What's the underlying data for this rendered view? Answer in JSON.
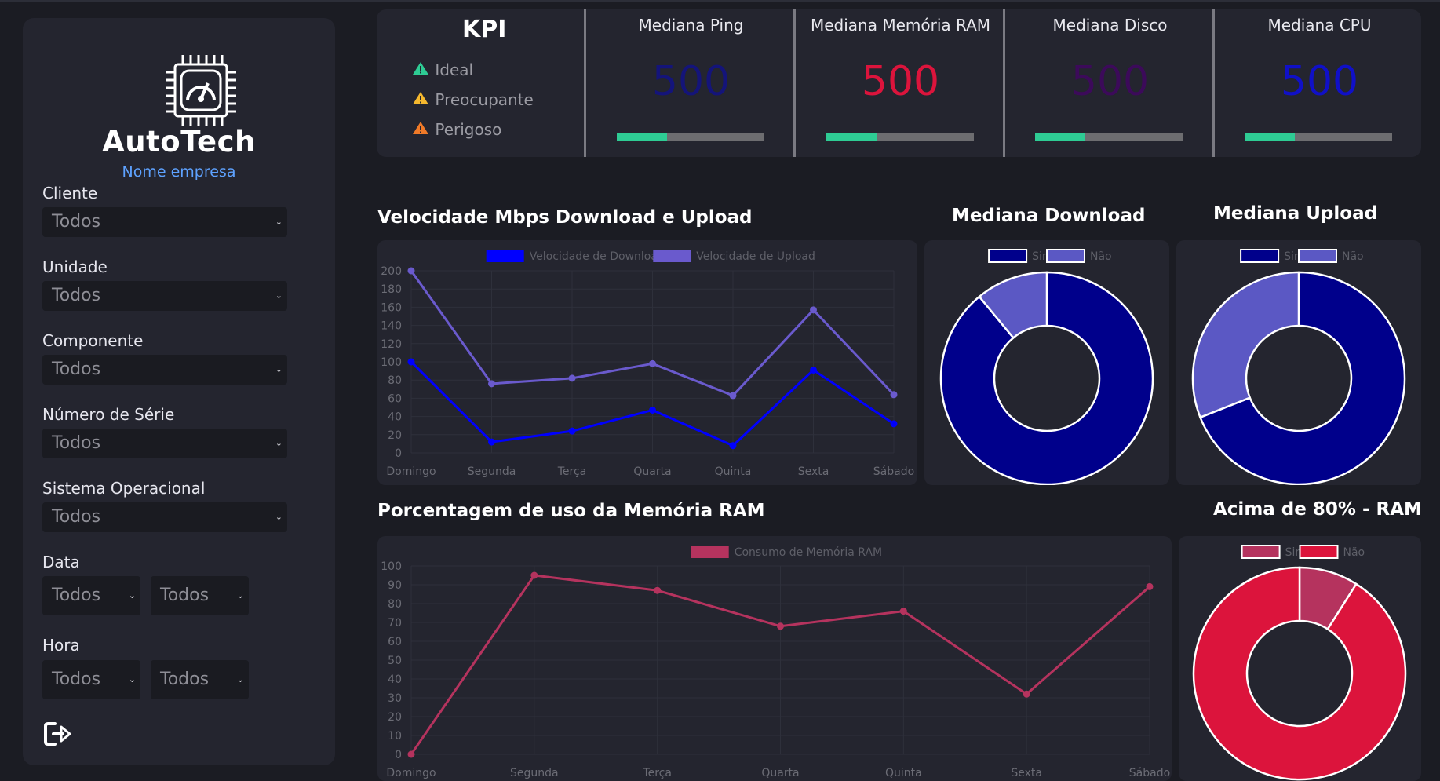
{
  "brand": {
    "name": "AutoTech",
    "company": "Nome empresa"
  },
  "filters": [
    {
      "label": "Cliente",
      "value": "Todos"
    },
    {
      "label": "Unidade",
      "value": "Todos"
    },
    {
      "label": "Componente",
      "value": "Todos"
    },
    {
      "label": "Número de Série",
      "value": "Todos"
    },
    {
      "label": "Sistema Operacional",
      "value": "Todos"
    }
  ],
  "data_filter": {
    "label": "Data",
    "from": "Todos",
    "to": "Todos"
  },
  "hora_filter": {
    "label": "Hora",
    "from": "Todos",
    "to": "Todos"
  },
  "kpi": {
    "title": "KPI",
    "legend": [
      {
        "label": "Ideal",
        "color": "#2ecc94"
      },
      {
        "label": "Preocupante",
        "color": "#f5b82e"
      },
      {
        "label": "Perigoso",
        "color": "#f07a28"
      }
    ],
    "cards": [
      {
        "title": "Mediana Ping",
        "value": "500",
        "color": "#14147a",
        "progress": 0.34
      },
      {
        "title": "Mediana Memória RAM",
        "value": "500",
        "color": "#dc143c",
        "progress": 0.34
      },
      {
        "title": "Mediana Disco",
        "value": "500",
        "color": "#3c0a5a",
        "progress": 0.34
      },
      {
        "title": "Mediana CPU",
        "value": "500",
        "color": "#1010c8",
        "progress": 0.34
      }
    ]
  },
  "colors": {
    "accent": "#2ecc94",
    "link": "#5ea2ff",
    "panel": "#24252f",
    "background": "#1b1c23"
  },
  "chart_data": [
    {
      "type": "line",
      "title": "Velocidade Mbps Download e Upload",
      "categories": [
        "Domingo",
        "Segunda",
        "Terça",
        "Quarta",
        "Quinta",
        "Sexta",
        "Sábado"
      ],
      "ylim": [
        0,
        200
      ],
      "yticks": [
        0,
        20,
        40,
        60,
        80,
        100,
        120,
        140,
        160,
        180,
        200
      ],
      "legend": "top",
      "grid": true,
      "series": [
        {
          "name": "Velocidade de Download",
          "color": "#0000ff",
          "values": [
            100,
            12,
            24,
            47,
            8,
            91,
            32
          ]
        },
        {
          "name": "Velocidade de Upload",
          "color": "#6a5acd",
          "values": [
            200,
            76,
            82,
            98,
            63,
            157,
            64
          ]
        }
      ]
    },
    {
      "type": "pie",
      "title": "Mediana Download",
      "categories": [
        "Sim",
        "Não"
      ],
      "values": [
        89,
        11
      ],
      "colors": [
        "#00008b",
        "#5b58c4"
      ],
      "legend": "top"
    },
    {
      "type": "pie",
      "title": "Mediana Upload",
      "categories": [
        "Sim",
        "Não"
      ],
      "values": [
        69,
        31
      ],
      "colors": [
        "#00008b",
        "#5b58c4"
      ],
      "legend": "top"
    },
    {
      "type": "line",
      "title": "Porcentagem de uso da Memória RAM",
      "categories": [
        "Domingo",
        "Segunda",
        "Terça",
        "Quarta",
        "Quinta",
        "Sexta",
        "Sábado"
      ],
      "ylim": [
        0,
        100
      ],
      "yticks": [
        0,
        10,
        20,
        30,
        40,
        50,
        60,
        70,
        80,
        90,
        100
      ],
      "legend": "top",
      "grid": true,
      "series": [
        {
          "name": "Consumo de Memória RAM",
          "color": "#b5335e",
          "values": [
            0,
            95,
            87,
            68,
            76,
            32,
            89
          ]
        }
      ]
    },
    {
      "type": "pie",
      "title": "Acima de 80% - RAM",
      "categories": [
        "Sim",
        "Não"
      ],
      "values": [
        9,
        91
      ],
      "colors": [
        "#b5335e",
        "#dc143c"
      ],
      "legend": "top"
    }
  ]
}
